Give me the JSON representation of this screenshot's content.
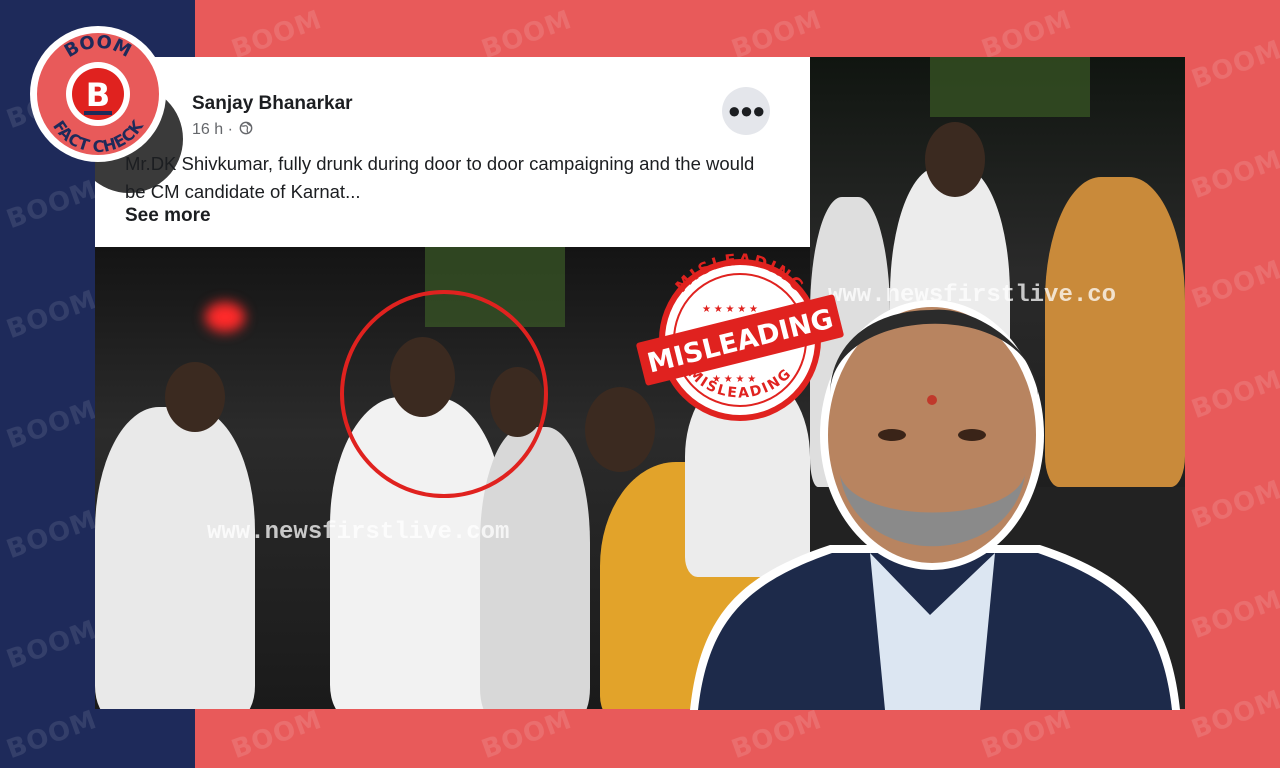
{
  "watermark": {
    "text": "BOOM"
  },
  "logo": {
    "top_text": "BOOM",
    "letter": "B",
    "bottom_text": "FACT CHECK"
  },
  "post": {
    "author": "Sanjay Bhanarkar",
    "time": "16 h ·",
    "privacy_icon": "globe-icon",
    "text": "Mr.DK Shivkumar, fully drunk during door to door campaigning and the would be CM candidate of Karnat...",
    "see_more": "See more",
    "more_icon": "ellipsis-icon"
  },
  "video_watermark": {
    "left": "www.newsfirstlive.com",
    "right": "www.newsfirstlive.co"
  },
  "stamp": {
    "label": "MISLEADING",
    "arc_top": "MISLEADING",
    "arc_bottom": "MISLEADING"
  },
  "colors": {
    "navy": "#1e2a5a",
    "coral": "#e85a5a",
    "stamp_red": "#e0221f",
    "white": "#ffffff"
  }
}
